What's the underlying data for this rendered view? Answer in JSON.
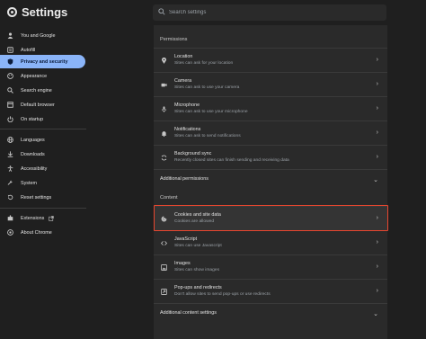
{
  "app": {
    "title": "Settings"
  },
  "search": {
    "placeholder": "Search settings"
  },
  "sidebar": {
    "items": [
      {
        "label": "You and Google",
        "icon": "person-icon"
      },
      {
        "label": "Autofill",
        "icon": "autofill-icon"
      },
      {
        "label": "Privacy and security",
        "icon": "shield-icon",
        "active": true
      },
      {
        "label": "Appearance",
        "icon": "palette-icon"
      },
      {
        "label": "Search engine",
        "icon": "search-icon"
      },
      {
        "label": "Default browser",
        "icon": "browser-icon"
      },
      {
        "label": "On startup",
        "icon": "power-icon"
      },
      {
        "label": "Languages",
        "icon": "globe-icon"
      },
      {
        "label": "Downloads",
        "icon": "download-icon"
      },
      {
        "label": "Accessibility",
        "icon": "accessibility-icon"
      },
      {
        "label": "System",
        "icon": "wrench-icon"
      },
      {
        "label": "Reset settings",
        "icon": "reset-icon"
      },
      {
        "label": "Extensions",
        "icon": "puzzle-icon"
      },
      {
        "label": "About Chrome",
        "icon": "chrome-icon"
      }
    ]
  },
  "main": {
    "permissions_title": "Permissions",
    "permissions": [
      {
        "title": "Location",
        "subtitle": "Sites can ask for your location",
        "icon": "location-icon"
      },
      {
        "title": "Camera",
        "subtitle": "Sites can ask to use your camera",
        "icon": "camera-icon"
      },
      {
        "title": "Microphone",
        "subtitle": "Sites can ask to use your microphone",
        "icon": "microphone-icon"
      },
      {
        "title": "Notifications",
        "subtitle": "Sites can ask to send notifications",
        "icon": "bell-icon"
      },
      {
        "title": "Background sync",
        "subtitle": "Recently closed sites can finish sending and receiving data",
        "icon": "sync-icon"
      }
    ],
    "additional_permissions": "Additional permissions",
    "content_title": "Content",
    "content": [
      {
        "title": "Cookies and site data",
        "subtitle": "Cookies are allowed",
        "icon": "cookie-icon"
      },
      {
        "title": "JavaScript",
        "subtitle": "Sites can use Javascript",
        "icon": "code-icon"
      },
      {
        "title": "Images",
        "subtitle": "Sites can show images",
        "icon": "image-icon"
      },
      {
        "title": "Pop-ups and redirects",
        "subtitle": "Don't allow sites to send pop-ups or use redirects",
        "icon": "popup-icon"
      }
    ],
    "additional_content": "Additional content settings"
  },
  "colors": {
    "accent": "#8ab4f8",
    "highlight": "#e8462f"
  }
}
